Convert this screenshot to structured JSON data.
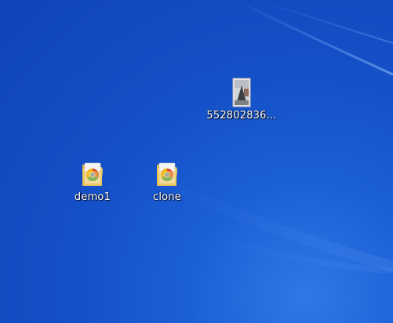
{
  "desktop": {
    "background_colors": {
      "base": "#1450c8",
      "light": "#2f78e6",
      "dark": "#0f44b8",
      "streak": "#7fb6ff"
    },
    "icons": [
      {
        "label": "552802836...",
        "icon": "image-file-icon"
      },
      {
        "label": "demo1",
        "icon": "chrome-folder-icon"
      },
      {
        "label": "clone",
        "icon": "chrome-folder-icon"
      }
    ]
  }
}
